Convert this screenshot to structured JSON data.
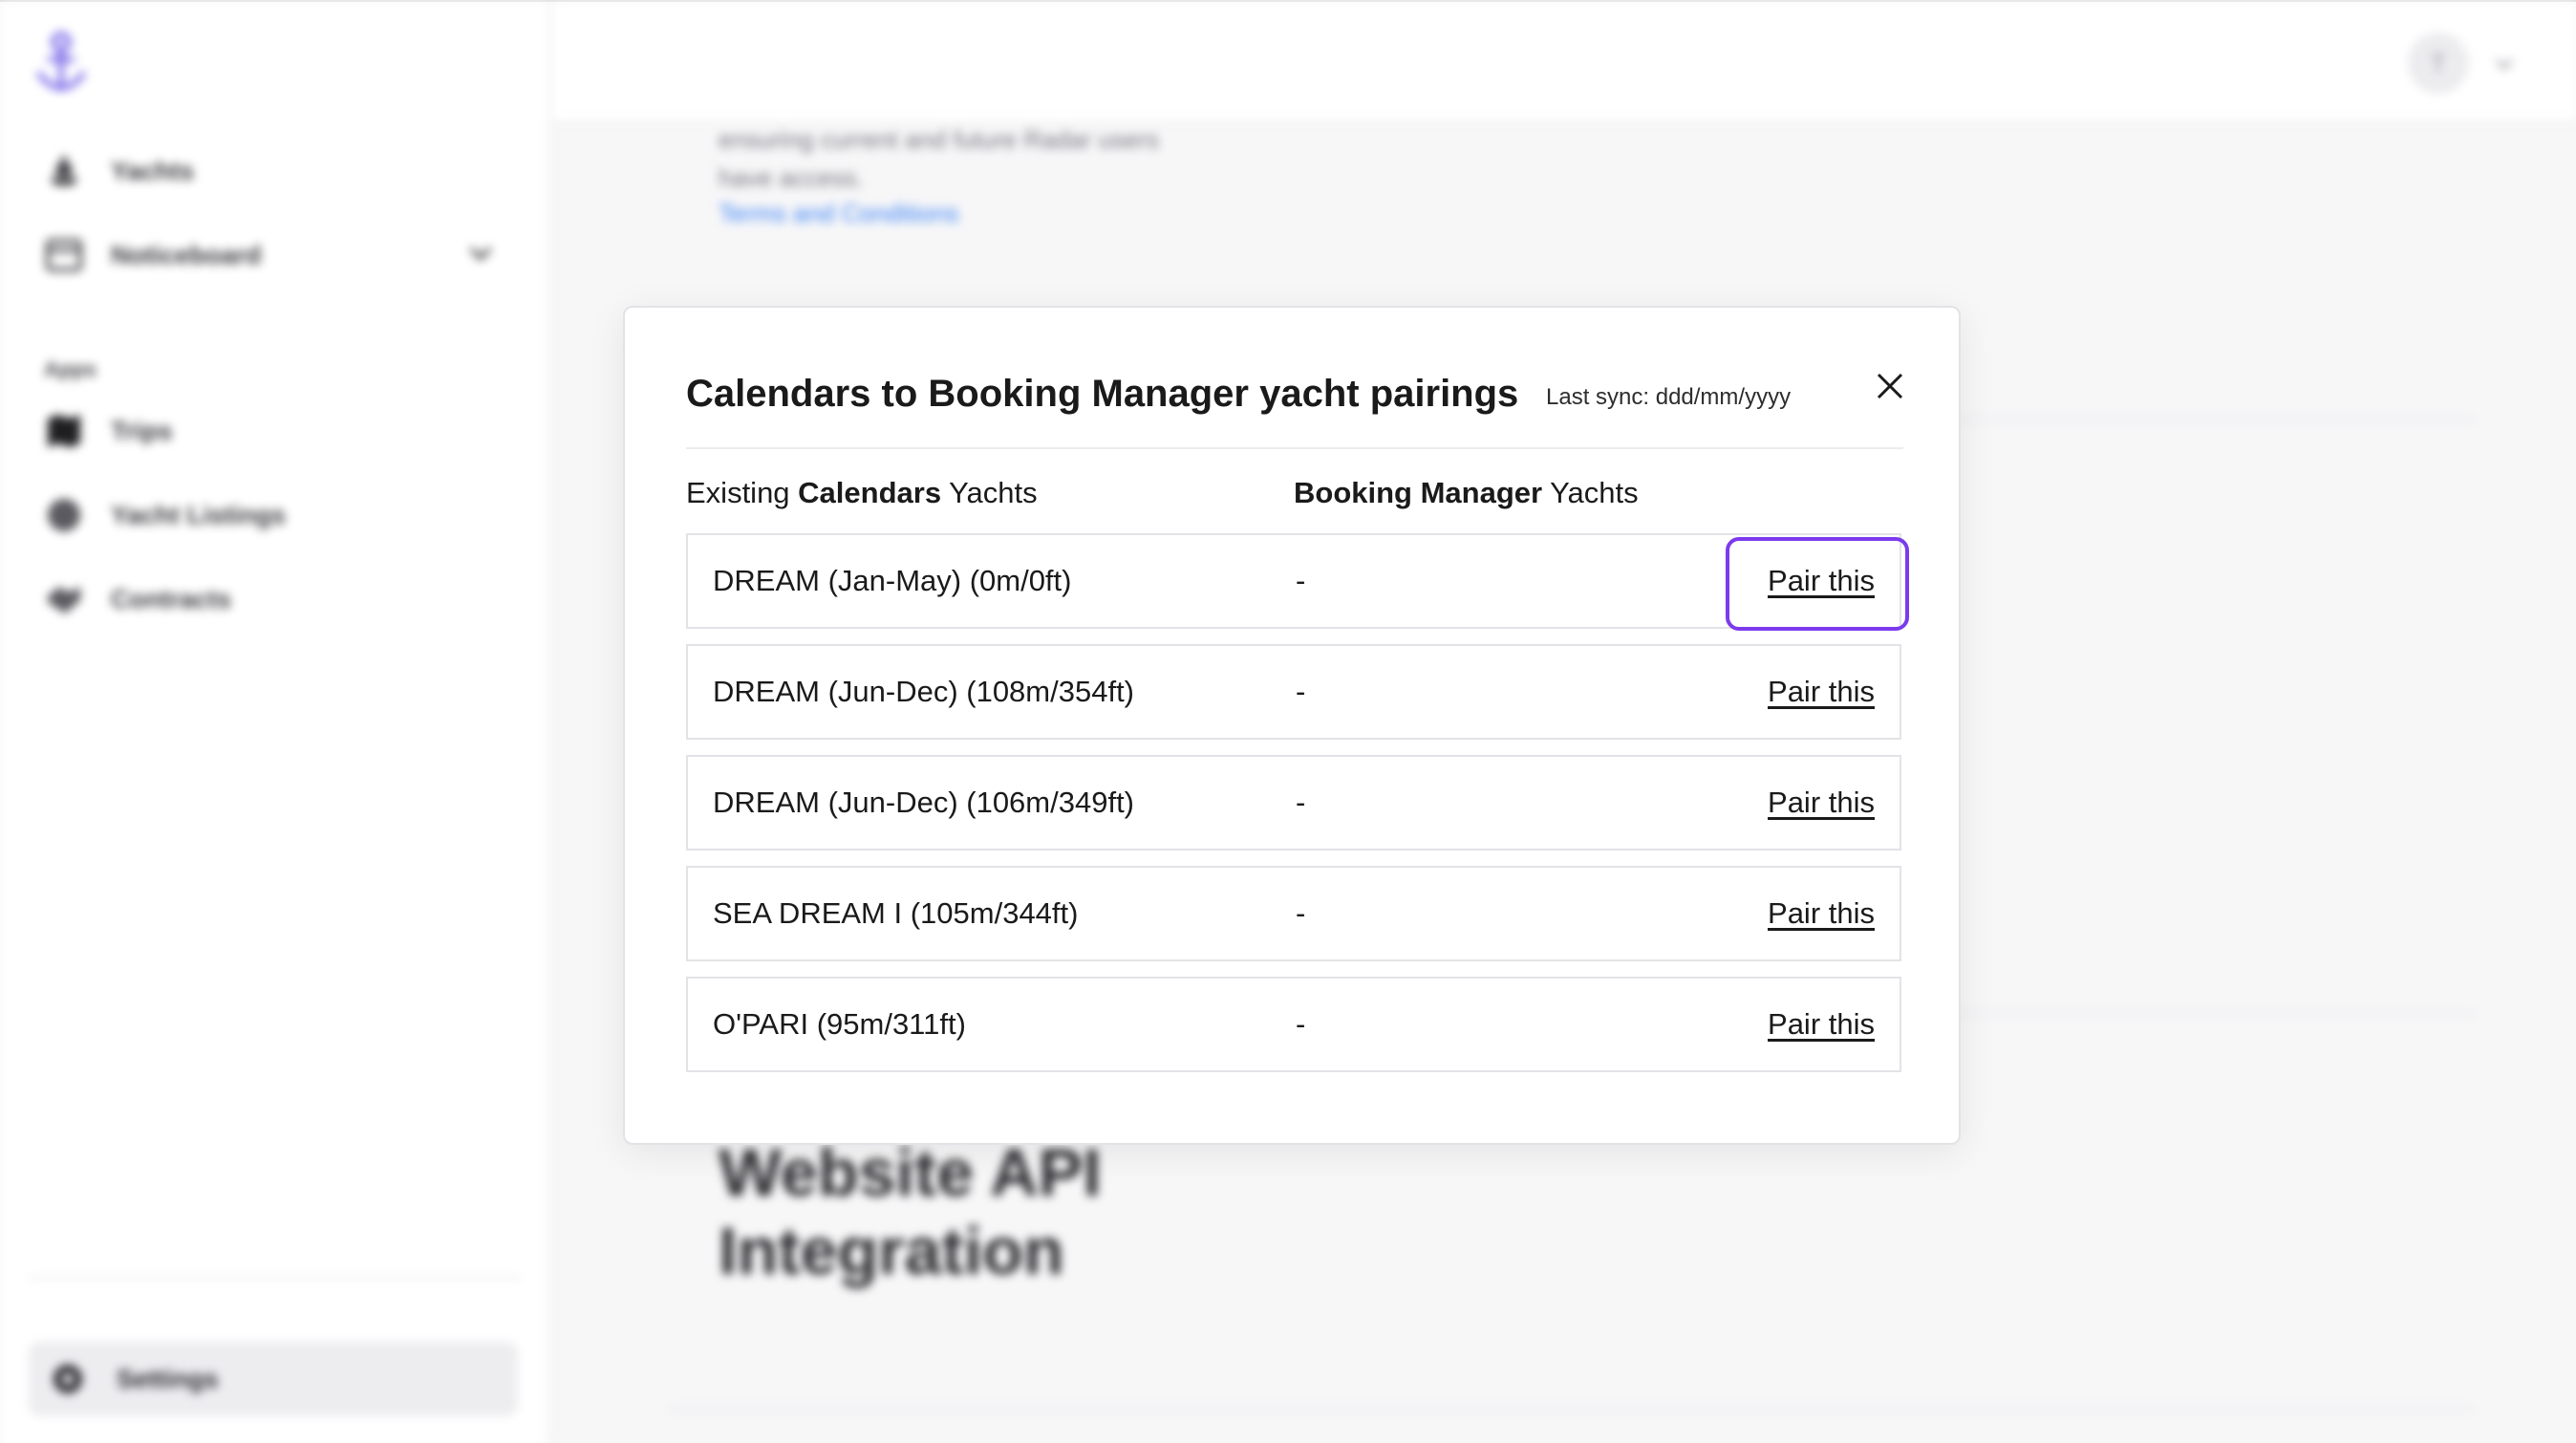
{
  "sidebar": {
    "nav_items": [
      {
        "label": "Yachts",
        "icon": "yacht-icon"
      },
      {
        "label": "Noticeboard",
        "icon": "noticeboard-icon"
      }
    ],
    "apps_label": "Apps",
    "app_items": [
      {
        "label": "Trips",
        "icon": "map-icon"
      },
      {
        "label": "Yacht Listings",
        "icon": "globe-icon"
      },
      {
        "label": "Contracts",
        "icon": "handshake-icon"
      }
    ],
    "settings_label": "Settings"
  },
  "topbar": {
    "avatar_initial": "T"
  },
  "background": {
    "text_lines": [
      "ensuring current and future Radar users",
      "have access."
    ],
    "link": "Terms and Conditions",
    "heading_lines": [
      "Website API",
      "Integration"
    ]
  },
  "modal": {
    "title": "Calendars to Booking Manager yacht pairings",
    "last_sync": "Last sync: ddd/mm/yyyy",
    "col1_prefix": "Existing ",
    "col1_bold": "Calendars",
    "col1_suffix": " Yachts",
    "col2_bold": "Booking Manager",
    "col2_suffix": " Yachts",
    "rows": [
      {
        "name": "DREAM (Jan-May) (0m/0ft)",
        "bm": "-",
        "action": "Pair this"
      },
      {
        "name": "DREAM (Jun-Dec) (108m/354ft)",
        "bm": "-",
        "action": "Pair this"
      },
      {
        "name": "DREAM (Jun-Dec) (106m/349ft)",
        "bm": "-",
        "action": "Pair this"
      },
      {
        "name": "SEA DREAM I (105m/344ft)",
        "bm": "-",
        "action": "Pair this"
      },
      {
        "name": "O'PARI (95m/311ft)",
        "bm": "-",
        "action": "Pair this"
      }
    ]
  },
  "colors": {
    "accent": "#7c3aed",
    "link": "#3b82f6",
    "logo": "#6d5ae6"
  }
}
